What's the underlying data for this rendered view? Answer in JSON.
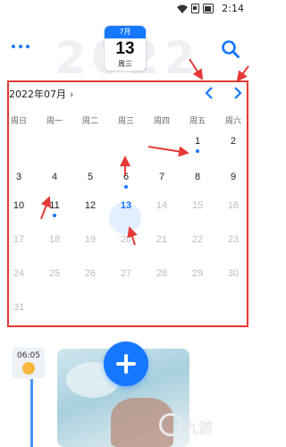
{
  "status_bar": {
    "time": "2:14"
  },
  "header": {
    "year_watermark": "2022",
    "badge": {
      "month": "7月",
      "day": "13",
      "weekday": "周三"
    }
  },
  "calendar": {
    "month_label": "2022年07月",
    "weekdays": [
      "周日",
      "周一",
      "周二",
      "周三",
      "周四",
      "周五",
      "周六"
    ],
    "weeks": [
      [
        "",
        "",
        "",
        "",
        "",
        "1",
        "2"
      ],
      [
        "3",
        "4",
        "5",
        "6",
        "7",
        "8",
        "9"
      ],
      [
        "10",
        "11",
        "12",
        "13",
        "14",
        "15",
        "16"
      ],
      [
        "17",
        "18",
        "19",
        "20",
        "21",
        "22",
        "23"
      ],
      [
        "24",
        "25",
        "26",
        "27",
        "28",
        "29",
        "30"
      ],
      [
        "31",
        "",
        "",
        "",
        "",
        "",
        ""
      ]
    ],
    "today": "13",
    "event_days": [
      "1",
      "6",
      "11"
    ]
  },
  "timeline": {
    "time": "06:05"
  },
  "watermark": {
    "text": "九游"
  },
  "colors": {
    "accent": "#1677ff",
    "annotation": "#e53935"
  },
  "icons": {
    "more": "more-dots-icon",
    "search": "search-icon",
    "prev": "chevron-left-icon",
    "next": "chevron-right-icon",
    "add": "plus-icon"
  }
}
